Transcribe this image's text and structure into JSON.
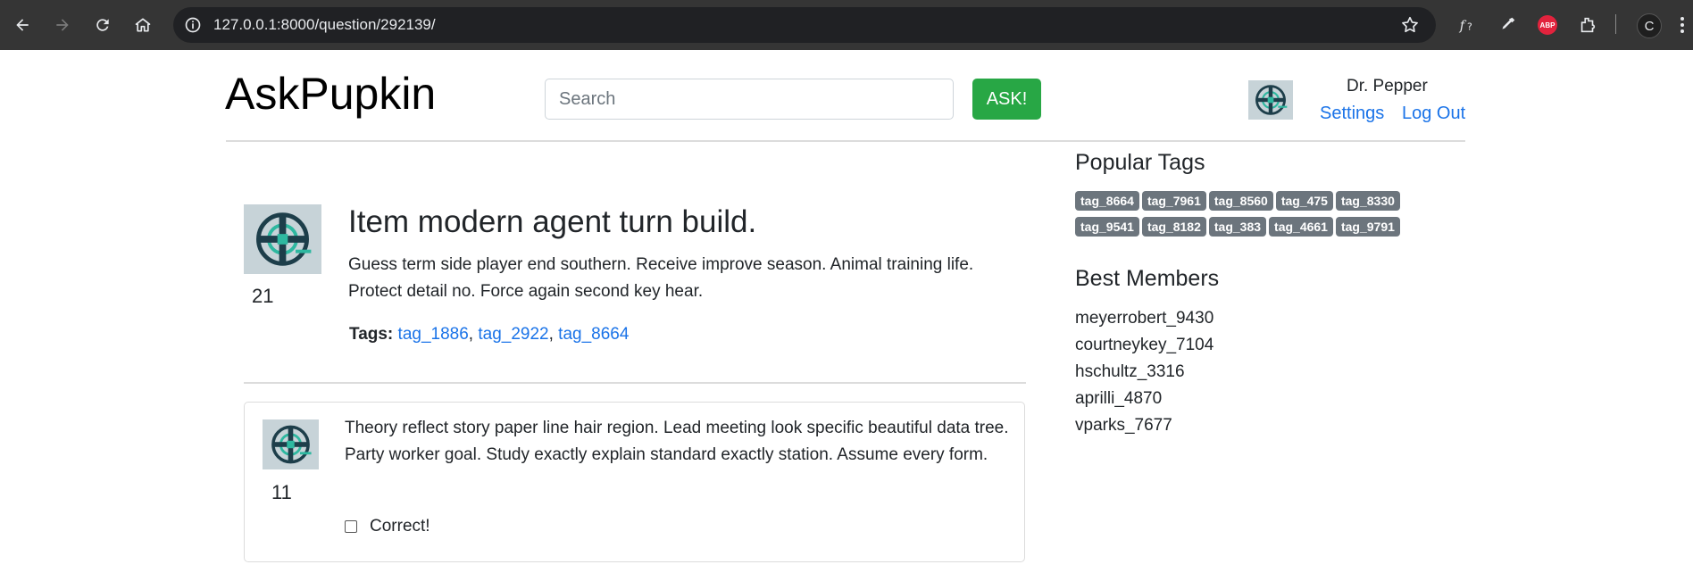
{
  "browser": {
    "url": "127.0.0.1:8000/question/292139/",
    "profile_initial": "C",
    "extensions": [
      "font-icon",
      "eyedropper-icon",
      "adblock-icon",
      "puzzle-icon"
    ]
  },
  "header": {
    "brand": "AskPupkin",
    "search_placeholder": "Search",
    "ask_label": "ASK!",
    "user_name": "Dr. Pepper",
    "settings_label": "Settings",
    "logout_label": "Log Out"
  },
  "question": {
    "title": "Item modern agent turn build.",
    "body": "Guess term side player end southern. Receive improve season. Animal training life. Protect detail no. Force again second key hear.",
    "votes": "21",
    "tags_label": "Tags:",
    "tags": [
      "tag_1886",
      "tag_2922",
      "tag_8664"
    ],
    "tag_separator": ","
  },
  "answers": [
    {
      "body": "Theory reflect story paper line hair region. Lead meeting look specific beautiful data tree. Party worker goal. Study exactly explain standard exactly station. Assume every form.",
      "votes": "11",
      "correct_label": "Correct!",
      "correct_checked": false
    }
  ],
  "sidebar": {
    "popular_tags_title": "Popular Tags",
    "popular_tags": [
      "tag_8664",
      "tag_7961",
      "tag_8560",
      "tag_475",
      "tag_8330",
      "tag_9541",
      "tag_8182",
      "tag_383",
      "tag_4661",
      "tag_9791"
    ],
    "best_members_title": "Best Members",
    "best_members": [
      "meyerrobert_9430",
      "courtneykey_7104",
      "hschultz_3316",
      "aprilli_4870",
      "vparks_7677"
    ]
  },
  "colors": {
    "accent_link": "#1a73e8",
    "ask_button": "#28a745",
    "badge": "#6c757d",
    "chrome_bg": "#353535"
  }
}
